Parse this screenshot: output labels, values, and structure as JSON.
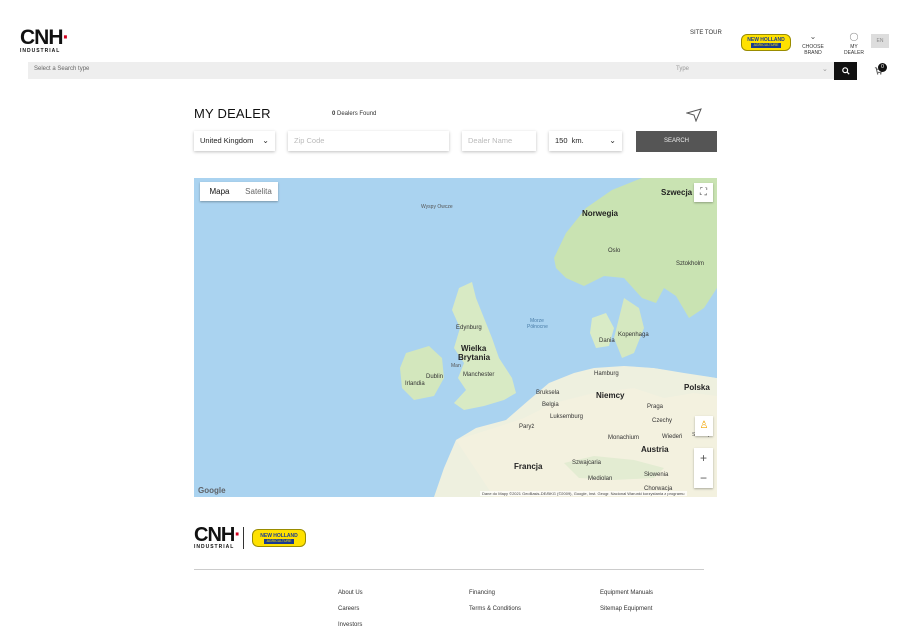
{
  "header": {
    "logo_text": "CNH",
    "logo_sub": "INDUSTRIAL",
    "site_tour": "SITE TOUR",
    "brand_badge_line1": "NEW HOLLAND",
    "brand_badge_line2": "AGRICULTURE",
    "choose_brand": "CHOOSE BRAND",
    "my_dealer": "MY DEALER",
    "lang": "EN"
  },
  "search": {
    "type_placeholder": "Select a Search type",
    "type_label": "Type",
    "cart_count": "0"
  },
  "dealer": {
    "title": "MY DEALER",
    "found_count": "0",
    "found_label": "Dealers Found",
    "country": "United Kingdom",
    "zip_placeholder": "Zip Code",
    "dealer_name_placeholder": "Dealer Name",
    "radius": "150  km.",
    "search_button": "SEARCH"
  },
  "map": {
    "tab_map": "Mapa",
    "tab_satellite": "Satelita",
    "google": "Google",
    "attribution": "Dane do Mapy ©2021 GeoBasis-DE/BKG (©2009), Google, Inst. Geogr. Nacional   Warunki korzystania z programu",
    "labels": {
      "faroe": "Wyspy Owcze",
      "norway": "Norwegia",
      "sweden": "Szwecja",
      "oslo": "Oslo",
      "stockholm": "Sztokholm",
      "edinburgh": "Edynburg",
      "uk_line1": "Wielka",
      "uk_line2": "Brytania",
      "isle_of_man": "Man",
      "manchester": "Manchester",
      "dublin": "Dublin",
      "ireland": "Irlandia",
      "north_sea_line1": "Morze",
      "north_sea_line2": "Północne",
      "denmark": "Dania",
      "copenhagen": "Kopenhaga",
      "hamburg": "Hamburg",
      "germany": "Niemcy",
      "poland": "Polska",
      "brussels": "Bruksela",
      "belgium": "Belgia",
      "luxembourg": "Luksemburg",
      "paris": "Paryż",
      "prague": "Praga",
      "czechia": "Czechy",
      "munich": "Monachium",
      "vienna": "Wiedeń",
      "austria": "Austria",
      "slovakia": "Słowacja",
      "switzerland": "Szwajcaria",
      "france": "Francja",
      "milan": "Mediolan",
      "slovenia": "Słowenia",
      "croatia": "Chorwacja"
    }
  },
  "footer": {
    "col1": [
      "About Us",
      "Careers",
      "Investors"
    ],
    "col2": [
      "Financing",
      "Terms & Conditions"
    ],
    "col3": [
      "Equipment Manuals",
      "Sitemap Equipment"
    ]
  }
}
